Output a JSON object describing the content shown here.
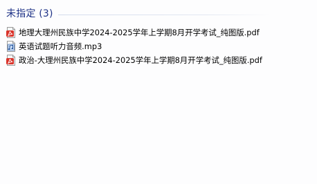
{
  "group": {
    "title": "未指定 (3)"
  },
  "files": [
    {
      "name": "地理大理州民族中学2024-2025学年上学期8月开学考试_纯图版.pdf",
      "icon": "pdf-icon"
    },
    {
      "name": "英语试题听力音频.mp3",
      "icon": "audio-file-icon"
    },
    {
      "name": "政治-大理州民族中学2024-2025学年上学期8月开学考试_纯图版.pdf",
      "icon": "pdf-icon"
    }
  ],
  "colors": {
    "group_title": "#1e3287",
    "pdf_red": "#d9342b"
  }
}
